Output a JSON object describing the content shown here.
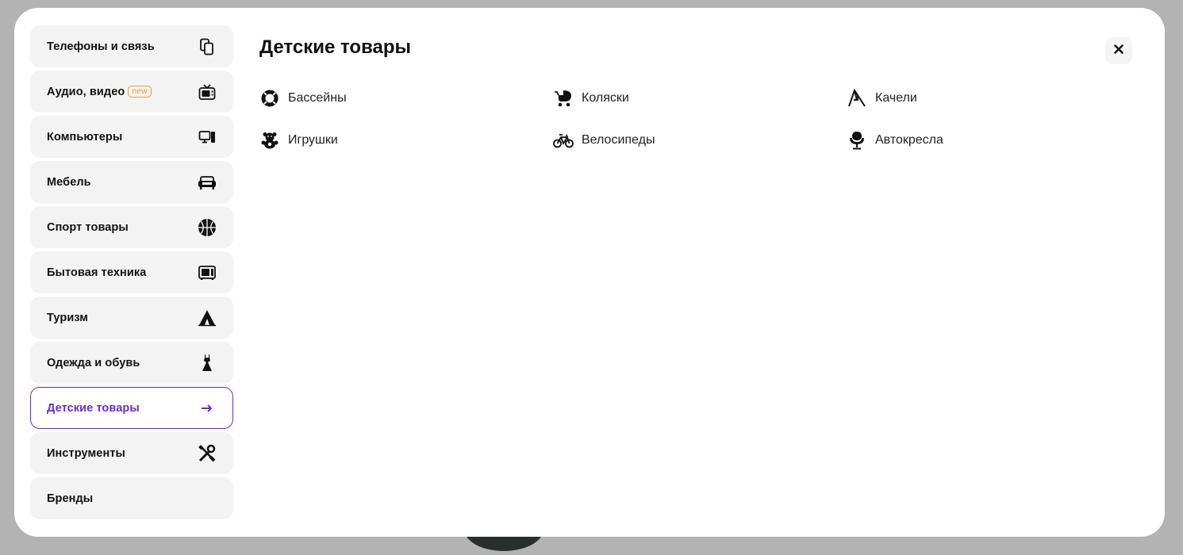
{
  "menu": {
    "categories": [
      {
        "label": "Телефоны и связь",
        "icon": "phones-icon"
      },
      {
        "label": "Аудио, видео",
        "badge": "new",
        "icon": "tv-icon"
      },
      {
        "label": "Компьютеры",
        "icon": "computer-icon"
      },
      {
        "label": "Мебель",
        "icon": "sofa-icon"
      },
      {
        "label": "Спорт товары",
        "icon": "basketball-icon"
      },
      {
        "label": "Бытовая техника",
        "icon": "microwave-icon"
      },
      {
        "label": "Туризм",
        "icon": "tent-icon"
      },
      {
        "label": "Одежда и обувь",
        "icon": "dress-icon"
      },
      {
        "label": "Детские товары",
        "icon": "arrow-right-icon",
        "active": true
      },
      {
        "label": "Инструменты",
        "icon": "tools-icon"
      },
      {
        "label": "Бренды"
      }
    ]
  },
  "panel": {
    "title": "Детские товары",
    "subcategories": [
      {
        "label": "Бассейны",
        "icon": "pool-ring-icon"
      },
      {
        "label": "Коляски",
        "icon": "stroller-icon"
      },
      {
        "label": "Качели",
        "icon": "swing-icon"
      },
      {
        "label": "Игрушки",
        "icon": "teddy-bear-icon"
      },
      {
        "label": "Велосипеды",
        "icon": "bicycle-icon"
      },
      {
        "label": "Автокресла",
        "icon": "car-seat-icon"
      }
    ]
  },
  "colors": {
    "accent": "#6b2bd9",
    "badge": "#f0a020",
    "item_bg": "#f3f3f3"
  }
}
